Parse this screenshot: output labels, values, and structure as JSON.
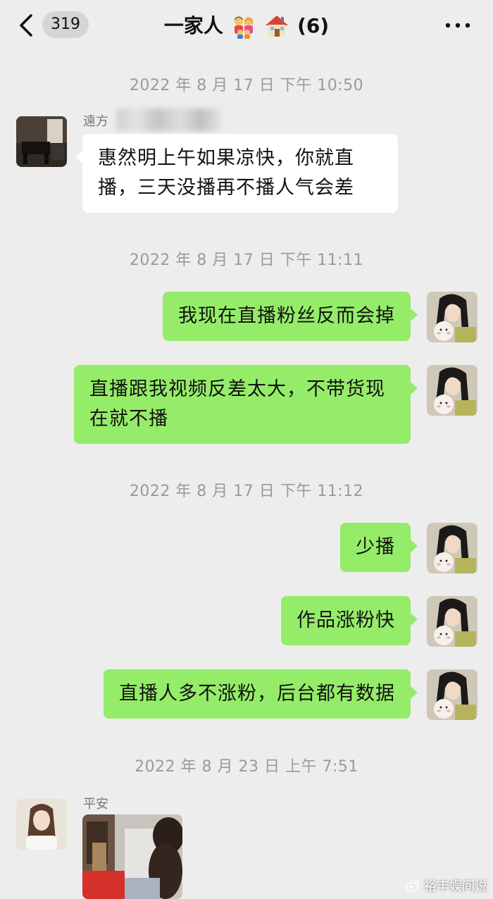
{
  "header": {
    "unread_count": "319",
    "title_text": "一家人",
    "title_icons": [
      "family-emoji-icon",
      "house-emoji-icon"
    ],
    "member_count": "(6)"
  },
  "messages": [
    {
      "type": "timestamp",
      "text": "2022 年 8 月 17 日  下午 10:50"
    },
    {
      "type": "incoming",
      "sender": "遠方",
      "text": "惠然明上午如果凉快，你就直播，三天没播再不播人气会差"
    },
    {
      "type": "timestamp",
      "text": "2022 年 8 月 17 日  下午 11:11"
    },
    {
      "type": "outgoing",
      "text": "我现在直播粉丝反而会掉"
    },
    {
      "type": "outgoing",
      "text": "直播跟我视频反差太大，不带货现在就不播"
    },
    {
      "type": "timestamp",
      "text": "2022 年 8 月 17 日  下午 11:12"
    },
    {
      "type": "outgoing",
      "text": "少播"
    },
    {
      "type": "outgoing",
      "text": "作品涨粉快"
    },
    {
      "type": "outgoing",
      "text": "直播人多不涨粉，后台都有数据"
    },
    {
      "type": "timestamp",
      "text": "2022 年 8 月 23 日  上午 7:51"
    },
    {
      "type": "incoming-image",
      "sender": "平安"
    }
  ],
  "watermark": "裕丰娱间说",
  "colors": {
    "background": "#ededed",
    "outgoing_bubble": "#95ec69",
    "incoming_bubble": "#ffffff",
    "timestamp_text": "#9a9a9a"
  }
}
